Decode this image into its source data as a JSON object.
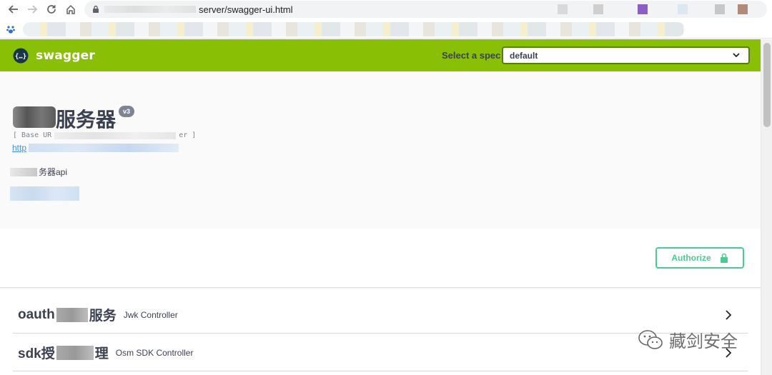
{
  "browser": {
    "address_visible": "server/swagger-ui.html"
  },
  "topbar": {
    "logo_text": "swagger",
    "select_label": "Select a spec",
    "select_value": "default"
  },
  "info": {
    "title": "服务器",
    "version_badge": "v3",
    "base_url_prefix": "[ Base UR",
    "base_url_suffix": "er ]",
    "spec_link_prefix": "http",
    "description": "务器api"
  },
  "scheme": {
    "authorize_label": "Authorize"
  },
  "tags": [
    {
      "name_prefix": "oauth",
      "name_suffix": "服务",
      "description": "Jwk Controller"
    },
    {
      "name_prefix": "sdk授",
      "name_suffix": "理",
      "description": "Osm SDK Controller"
    }
  ],
  "watermark": {
    "text": "藏剑安全"
  },
  "colors": {
    "topbar": "#89bf04",
    "select_border": "#547f00",
    "authorize": "#49cc90",
    "text": "#3b4151",
    "link": "#4990e2"
  }
}
